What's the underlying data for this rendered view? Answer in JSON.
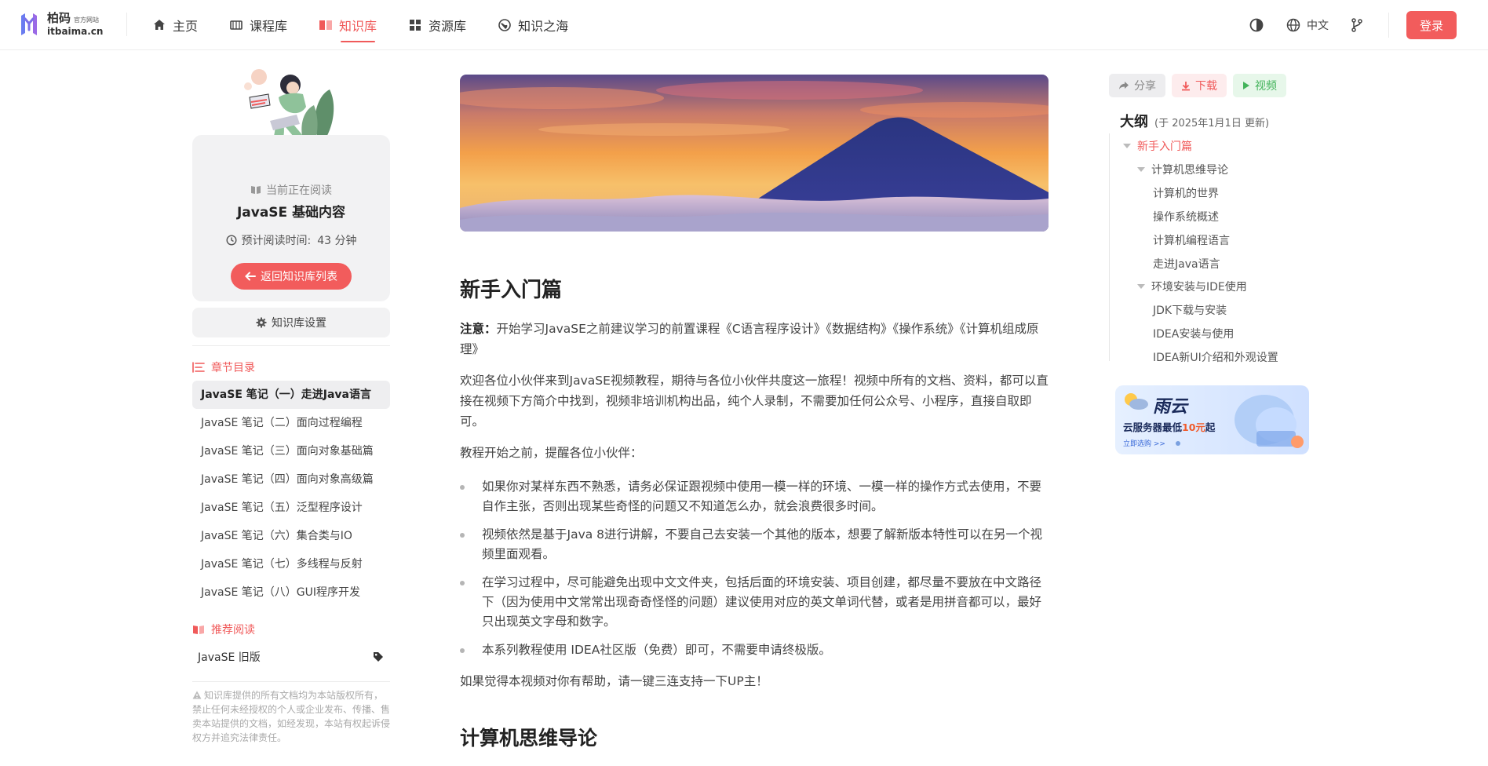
{
  "brand": {
    "name_cn": "柏码",
    "subtitle": "官方网站",
    "domain": "itbaima.cn"
  },
  "nav": [
    {
      "label": "主页",
      "icon": "home-icon"
    },
    {
      "label": "课程库",
      "icon": "course-icon"
    },
    {
      "label": "知识库",
      "icon": "book-icon",
      "active": true
    },
    {
      "label": "资源库",
      "icon": "grid-icon"
    },
    {
      "label": "知识之海",
      "icon": "globe-icon"
    }
  ],
  "header_right": {
    "theme_icon": "contrast-icon",
    "lang_label": "中文",
    "branch_icon": "branch-icon",
    "login_label": "登录"
  },
  "sidebar": {
    "reading_label": "当前正在阅读",
    "reading_title": "JavaSE 基础内容",
    "time_label": "预计阅读时间:",
    "time_value": "43 分钟",
    "back_label": "返回知识库列表",
    "settings_label": "知识库设置",
    "chapters_title": "章节目录",
    "chapters": [
      {
        "label": "JavaSE 笔记（一）走进Java语言",
        "active": true
      },
      {
        "label": "JavaSE 笔记（二）面向过程编程"
      },
      {
        "label": "JavaSE 笔记（三）面向对象基础篇"
      },
      {
        "label": "JavaSE 笔记（四）面向对象高级篇"
      },
      {
        "label": "JavaSE 笔记（五）泛型程序设计"
      },
      {
        "label": "JavaSE 笔记（六）集合类与IO"
      },
      {
        "label": "JavaSE 笔记（七）多线程与反射"
      },
      {
        "label": "JavaSE 笔记（八）GUI程序开发"
      }
    ],
    "recommend_title": "推荐阅读",
    "recommend_item": "JavaSE 旧版",
    "copyright": "知识库提供的所有文档均为本站版权所有，禁止任何未经授权的个人或企业发布、传播、售卖本站提供的文档，如经发现，本站有权起诉侵权方并追究法律责任。"
  },
  "article": {
    "h1": "新手入门篇",
    "note_label": "注意：",
    "note_text": "开始学习JavaSE之前建议学习的前置课程《C语言程序设计》《数据结构》《操作系统》《计算机组成原理》",
    "p1": "欢迎各位小伙伴来到JavaSE视频教程，期待与各位小伙伴共度这一旅程！视频中所有的文档、资料，都可以直接在视频下方简介中找到，视频非培训机构出品，纯个人录制，不需要加任何公众号、小程序，直接自取即可。",
    "p2": "教程开始之前，提醒各位小伙伴：",
    "bullets": [
      "如果你对某样东西不熟悉，请务必保证跟视频中使用一模一样的环境、一模一样的操作方式去使用，不要自作主张，否则出现某些奇怪的问题又不知道怎么办，就会浪费很多时间。",
      "视频依然是基于Java 8进行讲解，不要自己去安装一个其他的版本，想要了解新版本特性可以在另一个视频里面观看。",
      "在学习过程中，尽可能避免出现中文文件夹，包括后面的环境安装、项目创建，都尽量不要放在中文路径下（因为使用中文常常出现奇奇怪怪的问题）建议使用对应的英文单词代替，或者是用拼音都可以，最好只出现英文字母和数字。",
      "本系列教程使用 IDEA社区版（免费）即可，不需要申请终极版。"
    ],
    "p3": "如果觉得本视频对你有帮助，请一键三连支持一下UP主！",
    "h2": "计算机思维导论"
  },
  "right": {
    "share_label": "分享",
    "download_label": "下载",
    "video_label": "视频",
    "outline_title": "大纲",
    "outline_date": "(于 2025年1月1日 更新)",
    "toc": [
      {
        "label": "新手入门篇",
        "level": 0,
        "caret": true,
        "active": true
      },
      {
        "label": "计算机思维导论",
        "level": 1,
        "caret": true
      },
      {
        "label": "计算机的世界",
        "level": 2
      },
      {
        "label": "操作系统概述",
        "level": 2
      },
      {
        "label": "计算机编程语言",
        "level": 2
      },
      {
        "label": "走进Java语言",
        "level": 2
      },
      {
        "label": "环境安装与IDE使用",
        "level": 1,
        "caret": true
      },
      {
        "label": "JDK下载与安装",
        "level": 2
      },
      {
        "label": "IDEA安装与使用",
        "level": 2
      },
      {
        "label": "IDEA新UI介绍和外观设置",
        "level": 2
      }
    ],
    "ad": {
      "brand": "雨云",
      "headline_pre": "云服务器最低",
      "headline_price": "10元",
      "headline_post": "起",
      "cta": "立即选购 >>"
    }
  },
  "colors": {
    "accent": "#f25c5c",
    "video_green": "#42b35a"
  }
}
